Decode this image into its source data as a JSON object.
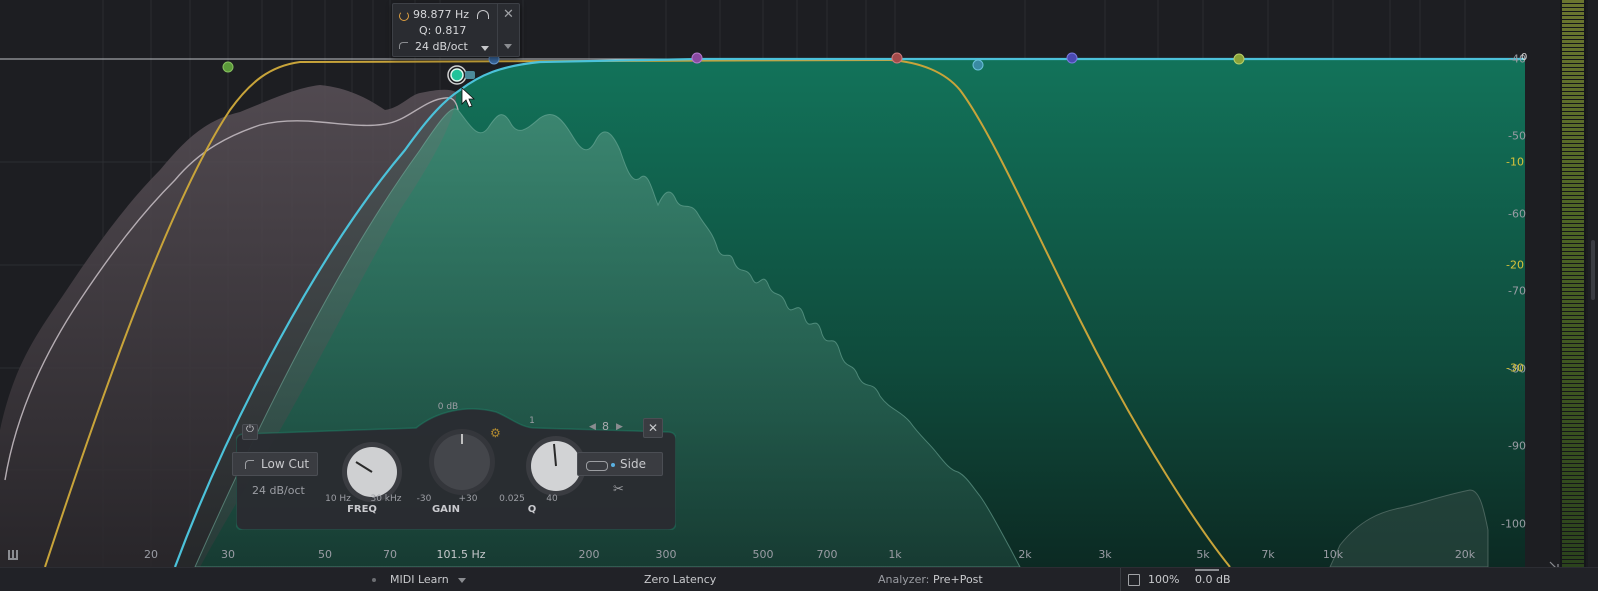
{
  "tooltip": {
    "frequency": "98.877 Hz",
    "q": "Q: 0.817",
    "slope": "24 dB/oct"
  },
  "freq_axis": {
    "labels": [
      "20",
      "30",
      "50",
      "70",
      "101.5 Hz",
      "200",
      "300",
      "500",
      "700",
      "1k",
      "2k",
      "3k",
      "5k",
      "7k",
      "10k",
      "20k"
    ]
  },
  "db_axis_right": {
    "labels": [
      "-40",
      "-50",
      "-60",
      "-70",
      "-80",
      "-90",
      "-100"
    ]
  },
  "gain_axis": {
    "zero_label": "0",
    "labels": [
      "-10",
      "-20",
      "-30"
    ]
  },
  "band_panel": {
    "filter_type": "Low Cut",
    "slope": "24 dB/oct",
    "freq_min": "10 Hz",
    "freq_max": "30 kHz",
    "freq_title": "FREQ",
    "gain_top": "0 dB",
    "gain_min": "-30",
    "gain_max": "+30",
    "gain_title": "GAIN",
    "q_top": "1",
    "q_min": "0.025",
    "q_max": "40",
    "q_title": "Q",
    "band_number": "8",
    "stereo_mode": "Side"
  },
  "status_bar": {
    "midi_learn": "MIDI Learn",
    "latency": "Zero Latency",
    "analyzer_label": "Analyzer:",
    "analyzer_value": "Pre+Post",
    "zoom": "100%",
    "output_gain": "0.0 dB"
  },
  "colors": {
    "accent_teal": "#1fb890",
    "cyan_curve": "#4cc2da",
    "yellow_curve": "#c8a43a",
    "gain_scale": "#d8c23a",
    "meter_green": "#6f9a2a"
  }
}
